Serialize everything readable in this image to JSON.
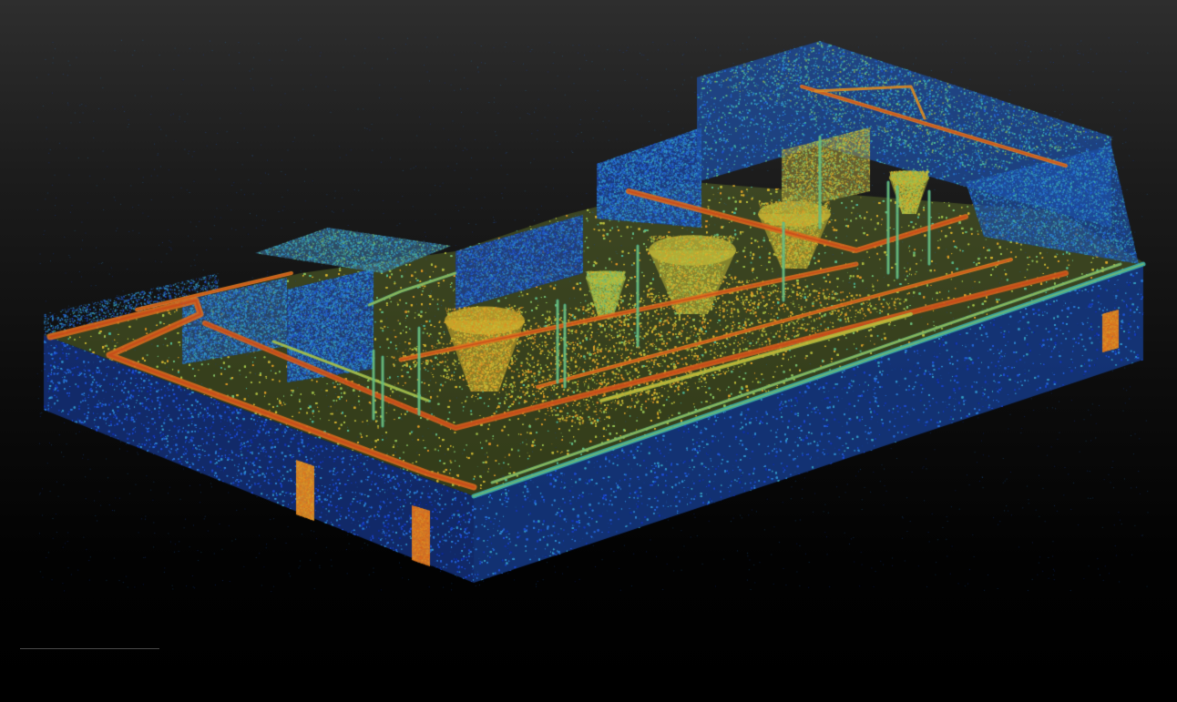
{
  "scene": {
    "subject": "point-cloud-scan-of-industrial-plant-room",
    "view": "isometric",
    "colormap": [
      "#0a1e8c",
      "#1f4fd8",
      "#2f8fd0",
      "#3fb7a8",
      "#9ec24a",
      "#d9b52f",
      "#e07a20",
      "#c8441a"
    ],
    "background_top": "#2e2e2e",
    "background_bottom": "#000000"
  }
}
